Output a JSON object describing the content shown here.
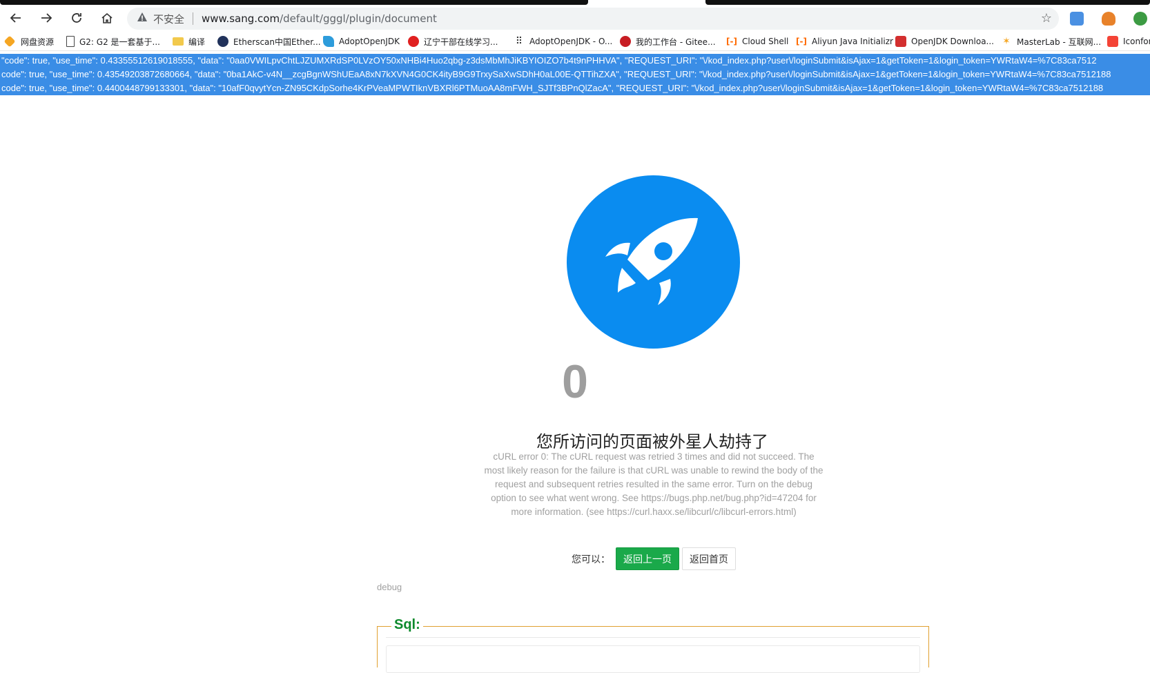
{
  "browser": {
    "security_label": "不安全",
    "url_host": "www.sang.com",
    "url_path": "/default/gggl/plugin/document"
  },
  "bookmarks": [
    {
      "label": "网盘资源",
      "icon": "diamond-icon",
      "color": "#f5a623"
    },
    {
      "label": "G2: G2 是一套基于...",
      "icon": "document-icon",
      "color": "#ffffff"
    },
    {
      "label": "编译",
      "icon": "folder-icon",
      "color": "#f2c94c"
    },
    {
      "label": "Etherscan中国Ether...",
      "icon": "etherscan-icon",
      "color": "#21325b"
    },
    {
      "label": "AdoptOpenJDK",
      "icon": "adoptopenjdk-icon",
      "color": "#2d9cdb"
    },
    {
      "label": "辽宁干部在线学习...",
      "icon": "circle-badge-icon",
      "color": "#e02020"
    },
    {
      "label": "AdoptOpenJDK - O...",
      "icon": "apps-grid-icon",
      "color": "#333333"
    },
    {
      "label": "我的工作台 - Gitee...",
      "icon": "gitee-icon",
      "color": "#c71d23"
    },
    {
      "label": "Cloud Shell",
      "icon": "aliyun-icon",
      "color": "#ff6a00"
    },
    {
      "label": "Aliyun Java Initializr",
      "icon": "aliyun-icon",
      "color": "#ff6a00"
    },
    {
      "label": "OpenJDK Downloa...",
      "icon": "openjdk-icon",
      "color": "#d32f2f"
    },
    {
      "label": "MasterLab - 互联网...",
      "icon": "butterfly-icon",
      "color": "#f5a623"
    },
    {
      "label": "Iconfon",
      "icon": "iconfont-icon",
      "color": "#f44336"
    }
  ],
  "selected_lines": [
    "\"code\": true, \"use_time\": 0.43355512619018555, \"data\": \"0aa0VWILpvChtLJZUMXRdSP0LVzOY50xNHBi4Huo2qbg-z3dsMbMhJiKBYIOIZO7b4t9nPHHVA\", \"REQUEST_URI\": \"\\/kod_index.php?user\\/loginSubmit&isAjax=1&getToken=1&login_token=YWRtaW4=%7C83ca7512",
    "code\": true, \"use_time\": 0.43549203872680664, \"data\": \"0ba1AkC-v4N__zcgBgnWShUEaA8xN7kXVN4G0CK4ityB9G9TrxySaXwSDhH0aL00E-QTTihZXA\", \"REQUEST_URI\": \"\\/kod_index.php?user\\/loginSubmit&isAjax=1&getToken=1&login_token=YWRtaW4=%7C83ca7512188",
    "code\": true, \"use_time\": 0.4400448799133301, \"data\": \"10afF0qvytYcn-ZN95CKdpSorhe4KrPVeaMPWTIknVBXRl6PTMuoAA8mFWH_SJTf3BPnQlZacA\", \"REQUEST_URI\": \"\\/kod_index.php?user\\/loginSubmit&isAjax=1&getToken=1&login_token=YWRtaW4=%7C83ca7512188"
  ],
  "error_page": {
    "code": "0",
    "title": "您所访问的页面被外星人劫持了",
    "description": "cURL error 0: The cURL request was retried 3 times and did not succeed. The most likely reason for the failure is that cURL was unable to rewind the body of the request and subsequent retries resulted in the same error. Turn on the debug option to see what went wrong. See https://bugs.php.net/bug.php?id=47204 for more information. (see https://curl.haxx.se/libcurl/c/libcurl-errors.html)",
    "actions_label": "您可以：",
    "back_button": "返回上一页",
    "home_button": "返回首页",
    "debug_label": "debug",
    "sql_legend": "Sql:"
  },
  "colors": {
    "selection": "#3a8de6",
    "rocket_circle": "#0a8cf0",
    "primary_button": "#1aa94a",
    "sql_legend": "#0d8a2c"
  }
}
